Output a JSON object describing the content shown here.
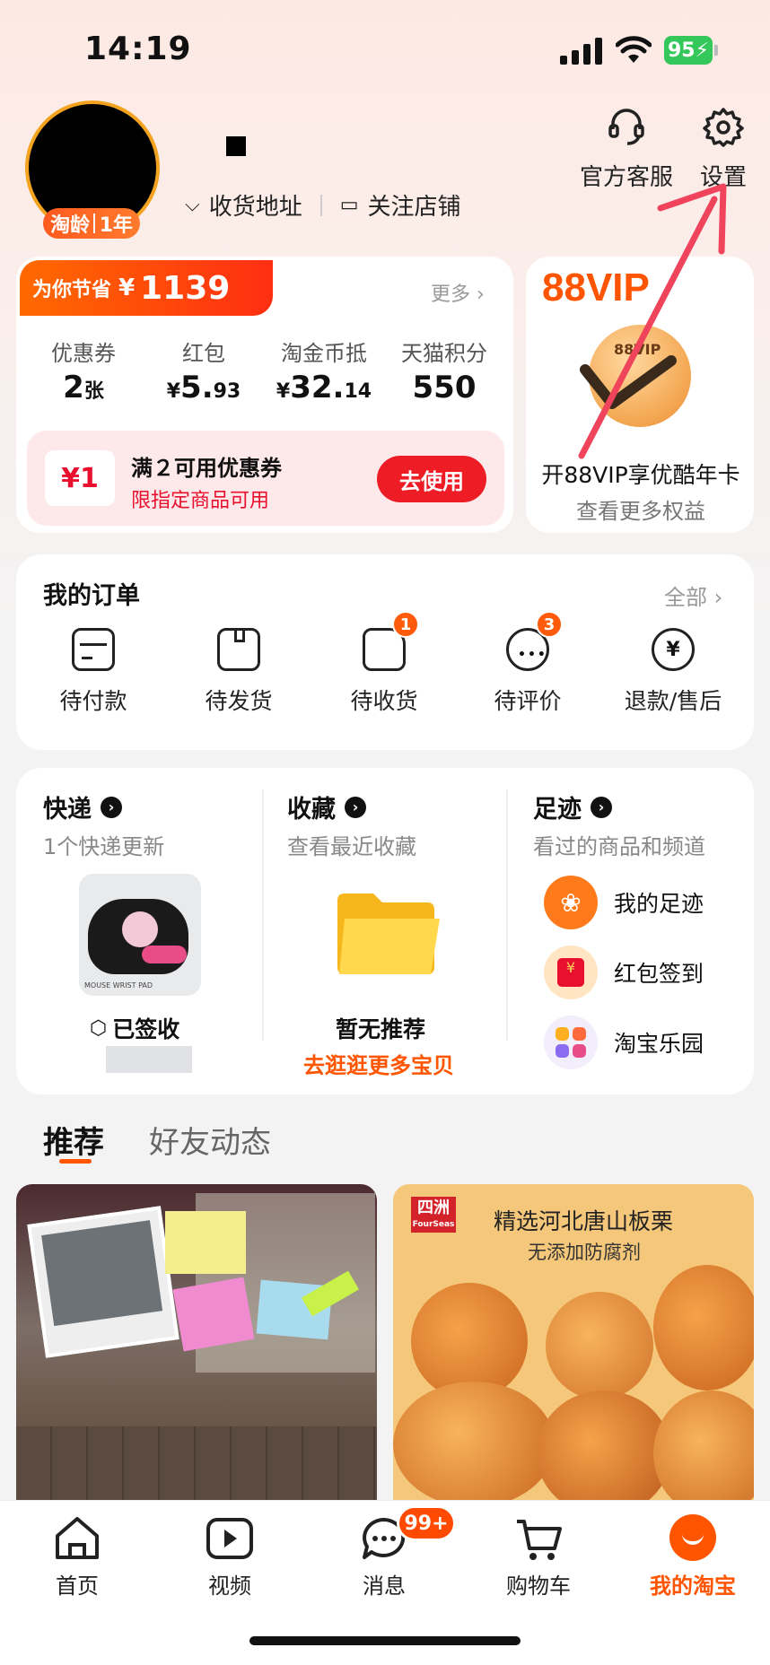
{
  "status_bar": {
    "time": "14:19",
    "battery": "95"
  },
  "profile": {
    "badge_left": "淘龄",
    "badge_right": "1年",
    "shipping_address": "收货地址",
    "followed_shops": "关注店铺"
  },
  "top_actions": {
    "customer_service": "官方客服",
    "settings": "设置"
  },
  "savings": {
    "label": "为你节省",
    "currency": "¥",
    "amount": "1139",
    "more": "更多"
  },
  "assets": [
    {
      "label": "优惠券",
      "value_main": "2",
      "value_sub": "张",
      "prefix": ""
    },
    {
      "label": "红包",
      "value_main": "5.",
      "value_sub": "93",
      "prefix": "¥"
    },
    {
      "label": "淘金币抵",
      "value_main": "32.",
      "value_sub": "14",
      "prefix": "¥"
    },
    {
      "label": "天猫积分",
      "value_main": "550",
      "value_sub": "",
      "prefix": ""
    }
  ],
  "coupon": {
    "ticket": "¥1",
    "title": "满２可用优惠券",
    "subtitle": "限指定商品可用",
    "button": "去使用"
  },
  "vip": {
    "title": "88VIP",
    "coin_text": "88VIP",
    "headline": "开88VIP享优酷年卡",
    "sub": "查看更多权益"
  },
  "orders": {
    "title": "我的订单",
    "all": "全部",
    "items": [
      {
        "label": "待付款",
        "icon": "wallet-icon",
        "badge": ""
      },
      {
        "label": "待发货",
        "icon": "package-icon",
        "badge": ""
      },
      {
        "label": "待收货",
        "icon": "truck-icon",
        "badge": "1"
      },
      {
        "label": "待评价",
        "icon": "comment-icon",
        "badge": "3"
      },
      {
        "label": "退款/售后",
        "icon": "refund-icon",
        "badge": ""
      }
    ]
  },
  "express": {
    "title": "快递",
    "sub": "1个快递更新",
    "status": "已签收",
    "product_text": "MOUSE WRIST PAD"
  },
  "favorites": {
    "title": "收藏",
    "sub": "查看最近收藏",
    "empty": "暂无推荐",
    "link": "去逛逛更多宝贝"
  },
  "footprints": {
    "title": "足迹",
    "sub": "看过的商品和频道",
    "items": [
      {
        "label": "我的足迹",
        "color": "#ff7a1a"
      },
      {
        "label": "红包签到",
        "color": "#ffe5c2"
      },
      {
        "label": "淘宝乐园",
        "color": "#f2eefb"
      }
    ]
  },
  "feed_tabs": {
    "recommend": "推荐",
    "friends": "好友动态"
  },
  "products": {
    "right_brand": "四洲",
    "right_brand_en": "FourSeas",
    "right_title": "精选河北唐山板栗",
    "right_sub": "无添加防腐剂"
  },
  "bottom_nav": [
    {
      "label": "首页",
      "icon": "home-icon"
    },
    {
      "label": "视频",
      "icon": "video-icon"
    },
    {
      "label": "消息",
      "icon": "message-icon",
      "badge": "99+"
    },
    {
      "label": "购物车",
      "icon": "cart-icon"
    },
    {
      "label": "我的淘宝",
      "icon": "taobao-face-icon"
    }
  ],
  "colors": {
    "accent": "#ff5500",
    "red": "#ee1c25",
    "annotation": "#f0445c"
  }
}
